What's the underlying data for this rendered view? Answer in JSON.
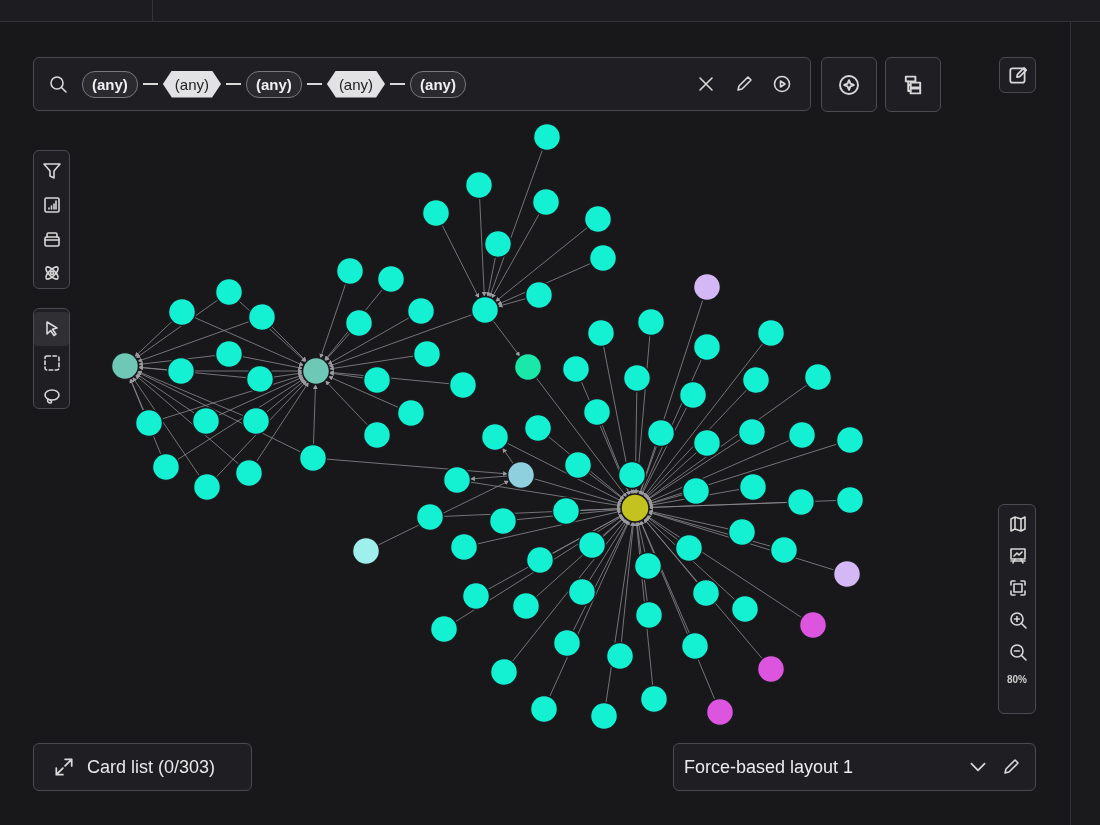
{
  "query": {
    "pattern": [
      {
        "kind": "node",
        "label": "(any)"
      },
      {
        "kind": "relationship",
        "label": "(any)"
      },
      {
        "kind": "node",
        "label": "(any)"
      },
      {
        "kind": "relationship",
        "label": "(any)"
      },
      {
        "kind": "node",
        "label": "(any)"
      }
    ]
  },
  "select_tools": [
    {
      "kind": "pointer",
      "selected": true
    },
    {
      "kind": "box",
      "selected": false
    },
    {
      "kind": "lasso",
      "selected": false
    }
  ],
  "zoom": {
    "reading": "80%"
  },
  "card_list": {
    "label": "Card list (0/303)"
  },
  "layout": {
    "value": "Force-based layout 1"
  }
}
